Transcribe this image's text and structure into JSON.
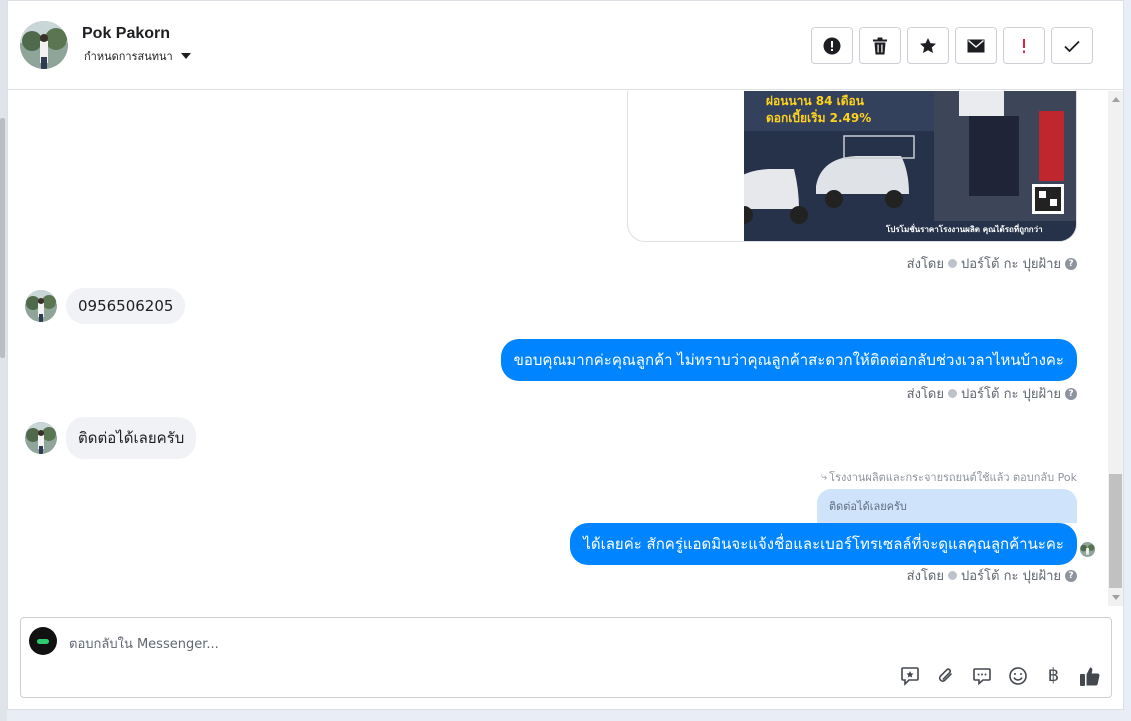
{
  "header": {
    "name": "Pok Pakorn",
    "subtitle": "กำหนดการสนทนา",
    "actions": [
      {
        "name": "report-icon",
        "label": "!"
      },
      {
        "name": "trash-icon"
      },
      {
        "name": "star-icon"
      },
      {
        "name": "envelope-icon"
      },
      {
        "name": "spam-icon",
        "label": "!"
      },
      {
        "name": "check-icon"
      }
    ]
  },
  "promo": {
    "text_line1": "ผ่อนนาน 84 เดือน",
    "text_line2": "ดอกเบี้ยเริ่ม 2.49%",
    "footer": "โปรโมชั่นราคาโรงงานผลิต คุณได้รถที่ถูกกว่า"
  },
  "meta": {
    "sent_by": "ส่งโดย",
    "author": "ปอร์โต้ กะ ปุยฝ้าย",
    "help": "?"
  },
  "messages": [
    {
      "direction": "in",
      "text": "0956506205"
    },
    {
      "direction": "out",
      "text": "ขอบคุณมากค่ะคุณลูกค้า ไม่ทราบว่าคุณลูกค้าสะดวกให้ติดต่อกลับช่วงเวลาไหนบ้างคะ"
    },
    {
      "direction": "in",
      "text": "ติดต่อได้เลยครับ"
    },
    {
      "direction": "out",
      "text": "ได้เลยค่ะ สักครู่แอดมินจะแจ้งชื่อและเบอร์โทรเซลล์ที่จะดูแลคุณลูกค้านะคะ"
    }
  ],
  "reply": {
    "note": "โรงงานผลิตและกระจายรถยนต์ใช้แล้ว ตอบกลับ Pok",
    "quoted": "ติดต่อได้เลยครับ"
  },
  "composer": {
    "placeholder": "ตอบกลับใน Messenger...",
    "tools": [
      "saved-reply-icon",
      "paperclip-icon",
      "chat-bubble-icon",
      "emoji-icon",
      "baht-icon",
      "thumbs-up-icon"
    ],
    "baht_glyph": "฿"
  },
  "colors": {
    "outgoing_bubble": "#0084ff",
    "incoming_bubble": "#f0f2f5",
    "quoted_bubble": "#cfe3fb"
  }
}
